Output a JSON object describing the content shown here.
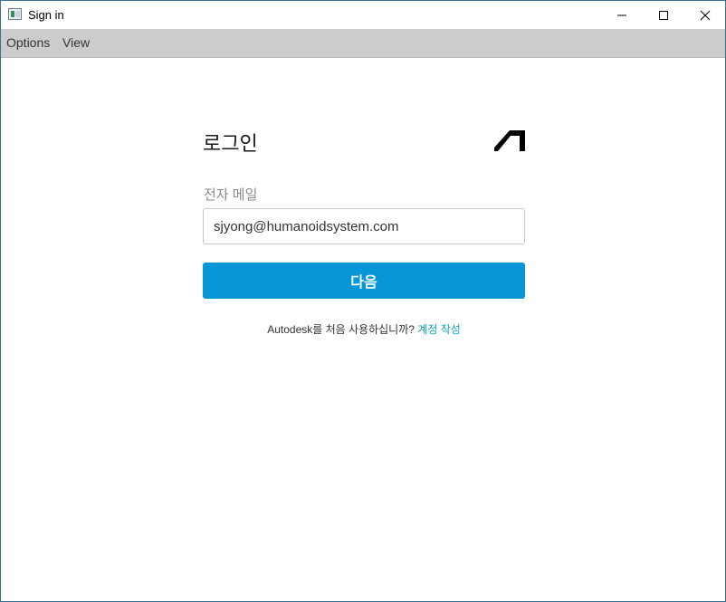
{
  "window": {
    "title": "Sign in",
    "controls": {
      "minimize": "—",
      "maximize": "☐",
      "close": "✕"
    }
  },
  "menu": {
    "items": [
      {
        "label": "Options"
      },
      {
        "label": "View"
      }
    ]
  },
  "login": {
    "heading": "로그인",
    "logo_icon": "autodesk-logo-icon",
    "email_label": "전자 메일",
    "email_value": "sjyong@humanoidsystem.com",
    "next_label": "다음",
    "signup_prompt": "Autodesk를 처음 사용하십니까?",
    "signup_link": "계정 작성"
  },
  "colors": {
    "primary_button": "#0796d8",
    "link": "#12a6b4",
    "menubar": "#cccccc"
  }
}
